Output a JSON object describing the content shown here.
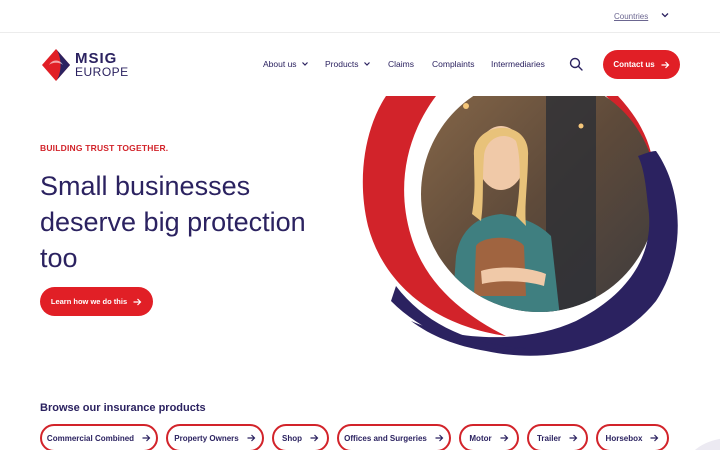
{
  "topbar": {
    "countries_label": "Countries"
  },
  "logo": {
    "line1": "MSIG",
    "line2": "EUROPE"
  },
  "nav": {
    "items": [
      {
        "label": "About us",
        "has_dropdown": true
      },
      {
        "label": "Products",
        "has_dropdown": true
      },
      {
        "label": "Claims",
        "has_dropdown": false
      },
      {
        "label": "Complaints",
        "has_dropdown": false
      },
      {
        "label": "Intermediaries",
        "has_dropdown": false
      }
    ],
    "contact_label": "Contact us"
  },
  "hero": {
    "eyebrow": "BUILDING TRUST TOGETHER.",
    "headline": "Small businesses deserve big protection too",
    "cta_label": "Learn how we do this"
  },
  "products": {
    "title": "Browse our insurance products",
    "items": [
      {
        "label": "Commercial Combined"
      },
      {
        "label": "Property Owners"
      },
      {
        "label": "Shop"
      },
      {
        "label": "Offices and Surgeries"
      },
      {
        "label": "Motor"
      },
      {
        "label": "Trailer"
      },
      {
        "label": "Horsebox"
      }
    ]
  },
  "colors": {
    "brand_red": "#e11f26",
    "brand_navy": "#2b2260"
  },
  "icons": [
    "chevron-down-icon",
    "search-icon",
    "arrow-right-icon",
    "msig-logo-mark"
  ]
}
